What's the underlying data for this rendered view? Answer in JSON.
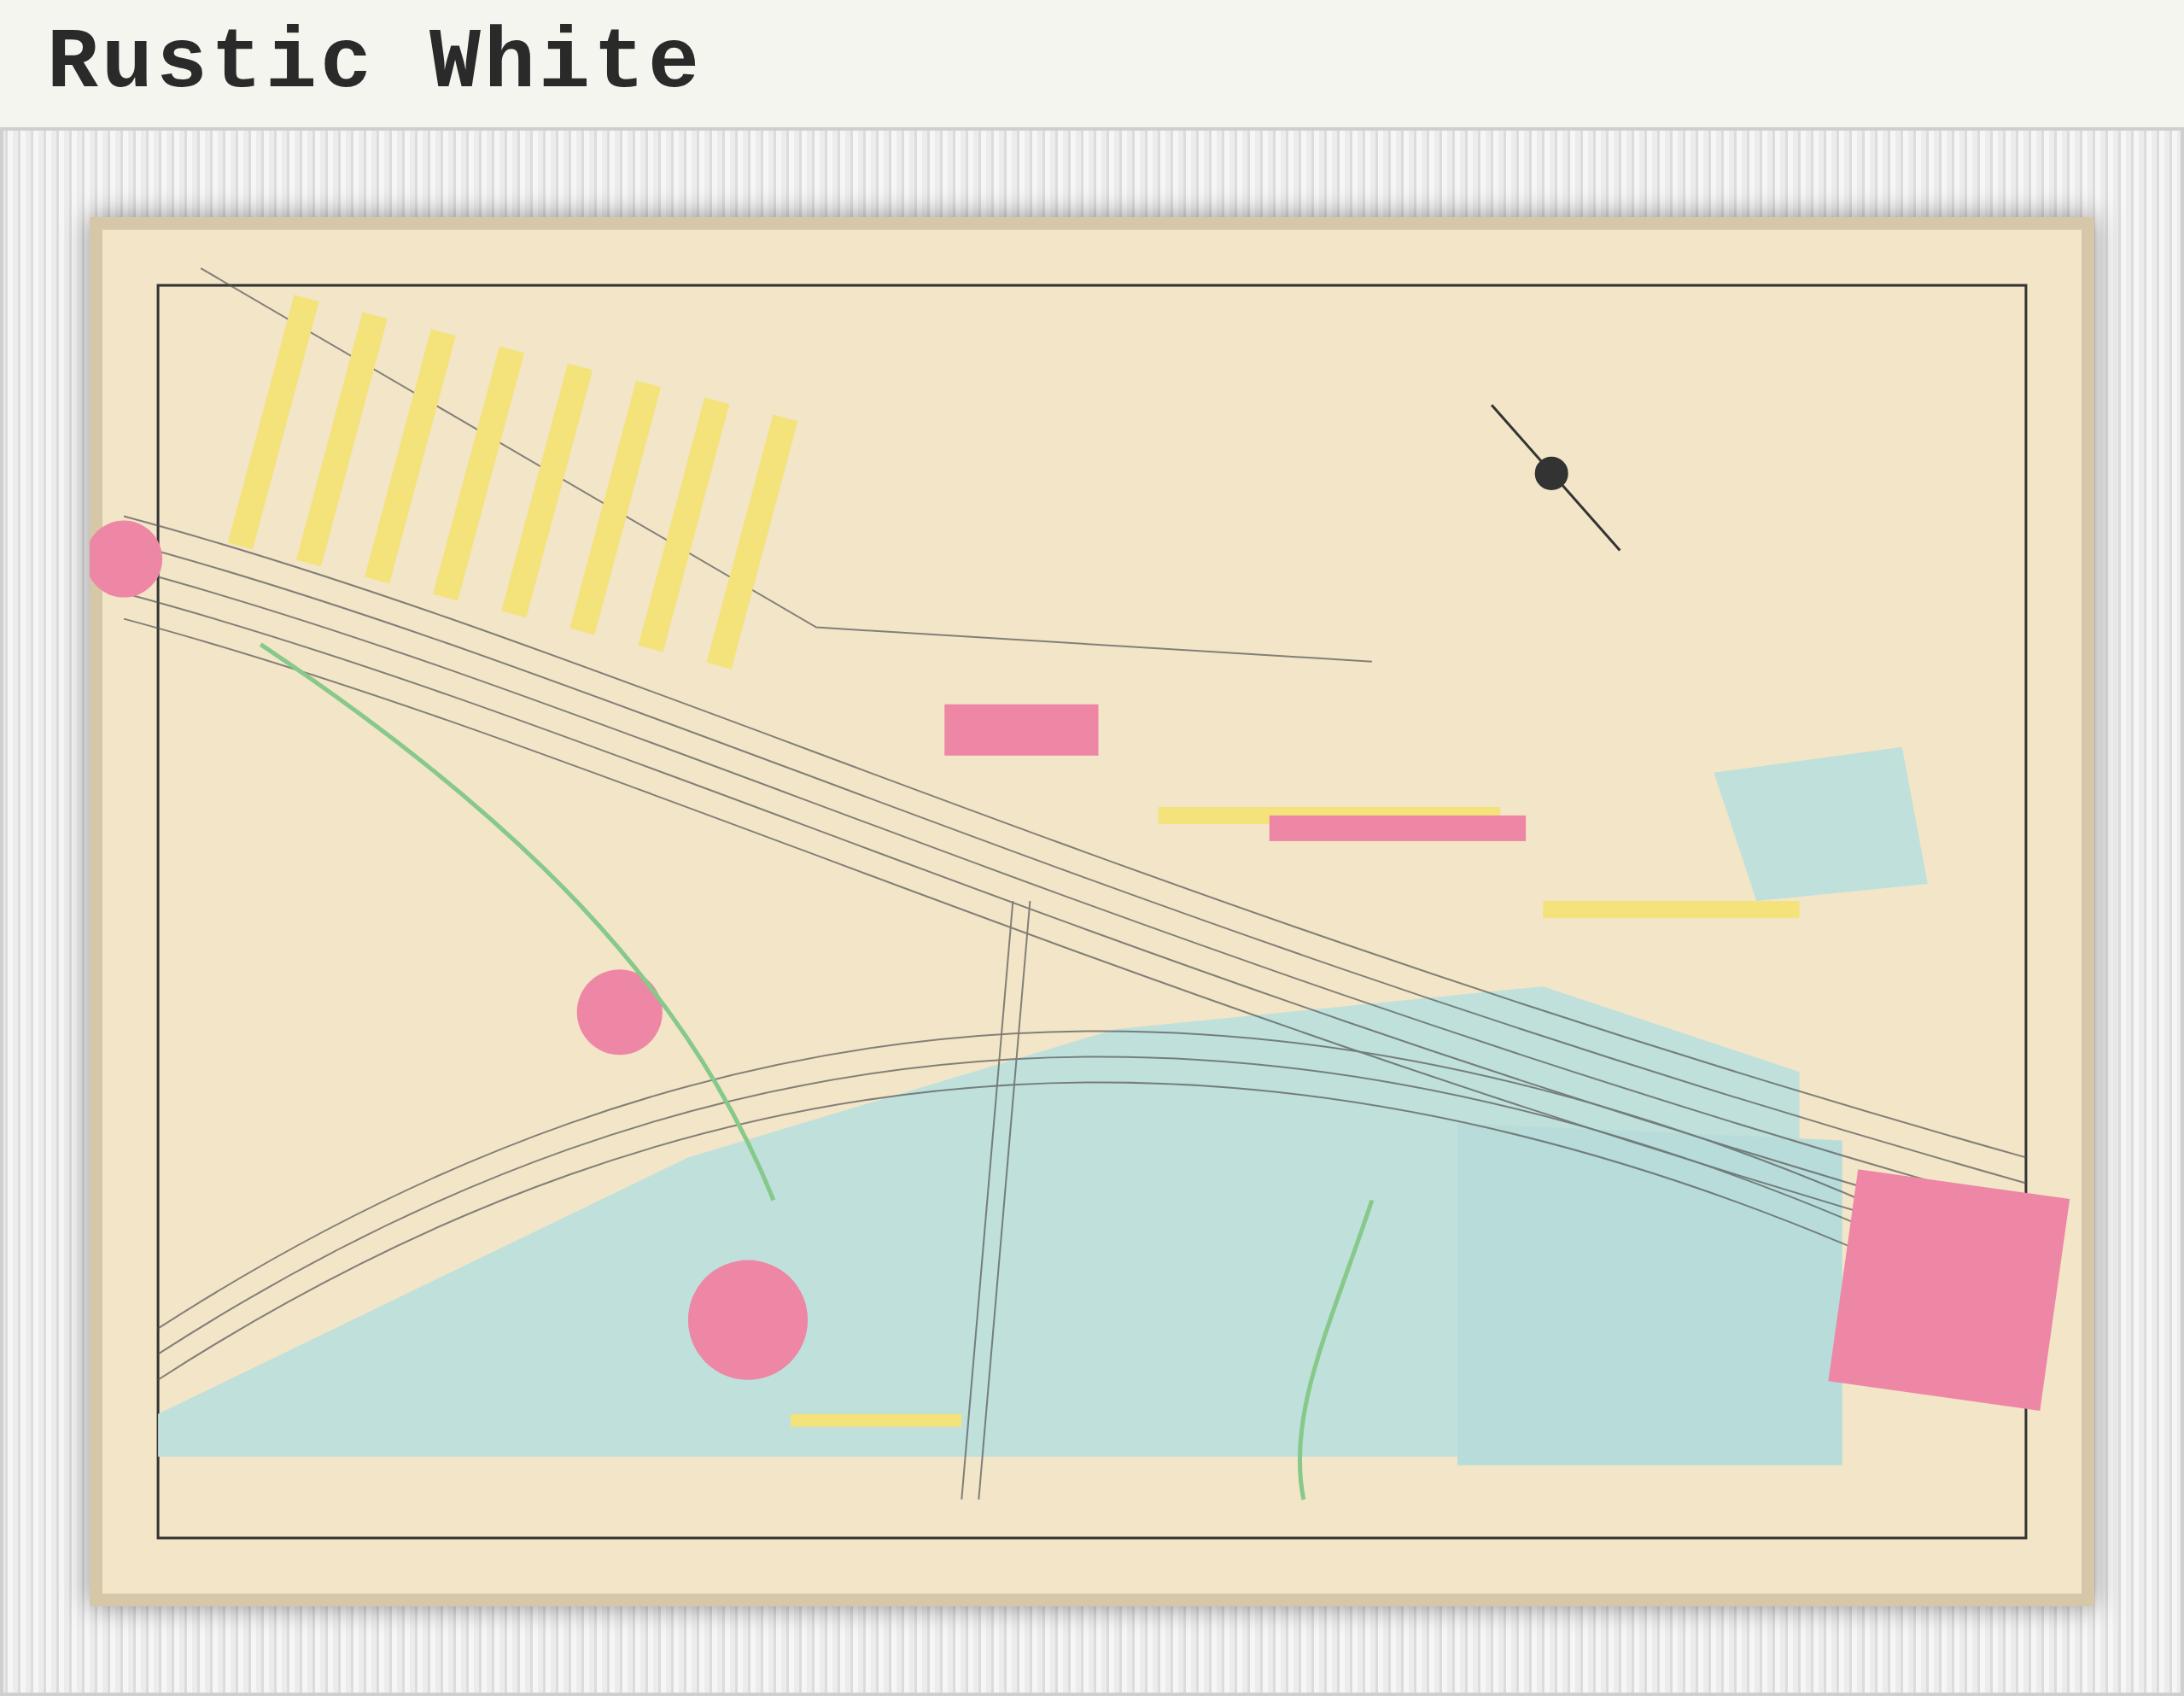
{
  "header": {
    "title": "Rustic White"
  }
}
